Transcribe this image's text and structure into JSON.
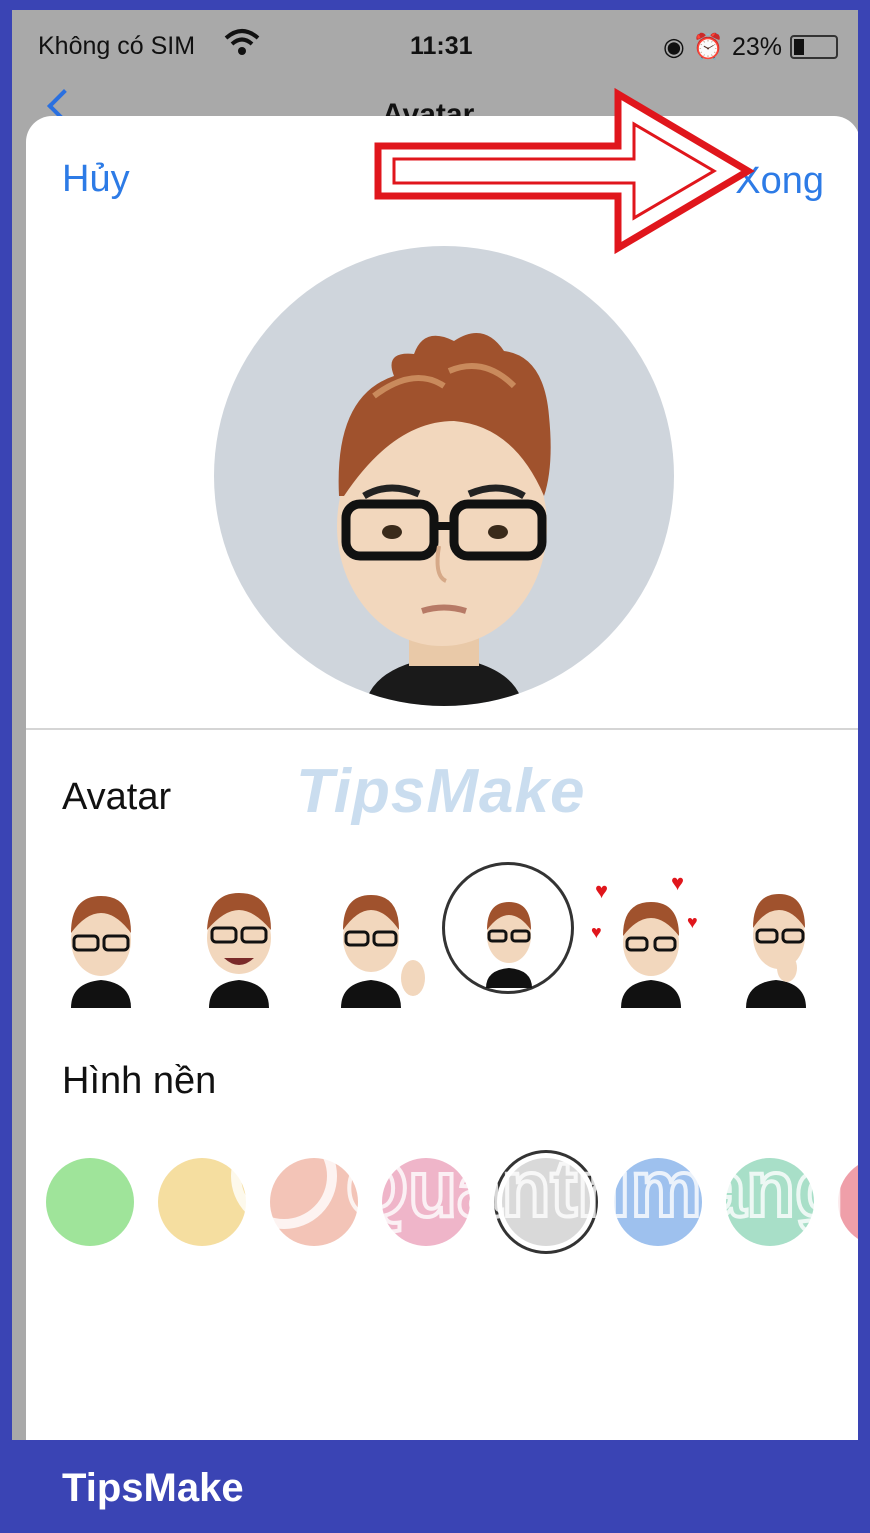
{
  "status_bar": {
    "carrier": "Không có SIM",
    "time": "11:31",
    "battery": "23%"
  },
  "background_nav": {
    "title": "Avatar"
  },
  "sheet": {
    "cancel_label": "Hủy",
    "done_label": "Xong"
  },
  "sections": {
    "avatar_label": "Avatar",
    "background_label": "Hình nền"
  },
  "watermarks": {
    "tipsmake_overlay": "TipsMake",
    "quantrimang_overlay": "Quantrimang"
  },
  "footer": {
    "brand": "TipsMake"
  },
  "background_colors": [
    "#9fe49a",
    "#f5dea0",
    "#f3c4b7",
    "#efb5c9",
    "#d9d9d9",
    "#9ec1ee",
    "#a8dfc8",
    "#ef9fa9"
  ],
  "colors": {
    "accent": "#2d7be6",
    "frame_blue": "#3a44b4",
    "arrow_red": "#e0161c"
  }
}
